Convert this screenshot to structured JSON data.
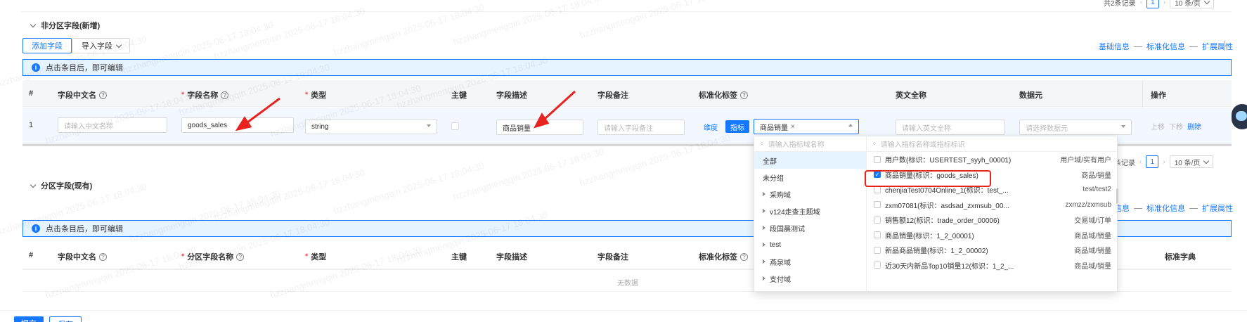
{
  "top_pager": {
    "total": "共2条记录",
    "page": "1",
    "size": "10 条/页"
  },
  "section1": {
    "title": "非分区字段(新增)",
    "add_btn": "添加字段",
    "import_btn": "导入字段",
    "steps": [
      "基础信息",
      "标准化信息",
      "扩展属性"
    ],
    "info": "点击条目后，即可编辑",
    "headers": {
      "idx": "#",
      "cn": "字段中文名",
      "name": "字段名称",
      "type": "类型",
      "pk": "主键",
      "desc": "字段描述",
      "remark": "字段备注",
      "tag": "标准化标签",
      "en": "英文全称",
      "meta": "数据元",
      "op": "操作"
    },
    "row": {
      "idx": "1",
      "cn_placeholder": "请输入中文名称",
      "name_value": "goods_sales",
      "type_value": "string",
      "desc_value": "商品销量",
      "remark_placeholder": "请输入字段备注",
      "tag_dim": "维度",
      "tag_ind": "指标",
      "tag_selected": "商品销量",
      "en_placeholder": "请输入英文全称",
      "meta_placeholder": "请选择数据元",
      "op_up": "上移",
      "op_down": "下移",
      "op_del": "删除"
    },
    "pager": {
      "total": "条记录",
      "page": "1",
      "size": "10 条/页"
    }
  },
  "section2": {
    "title": "分区字段(现有)",
    "steps": [
      "基础信息",
      "标准化信息",
      "扩展属性"
    ],
    "info": "点击条目后，即可编辑",
    "headers": {
      "idx": "#",
      "cn": "字段中文名",
      "name": "分区字段名称",
      "type": "类型",
      "pk": "主键",
      "desc": "字段描述",
      "remark": "字段备注",
      "tag": "标准化标签",
      "dict": "标准字典"
    },
    "empty": "无数据"
  },
  "dropdown": {
    "left_search_placeholder": "请输入指标域名称",
    "right_search_placeholder": "请输入指标名称或指标标识",
    "domains": [
      "全部",
      "未分组",
      "采购域",
      "v124走查主题域",
      "段国晨测试",
      "test",
      "燕泉域",
      "支付域"
    ],
    "options": [
      {
        "label": "用户数(标识：USERTEST_syyh_00001)",
        "domain": "用户域/实有用户",
        "checked": false
      },
      {
        "label": "商品销量(标识：goods_sales)",
        "domain": "商品/销量",
        "checked": true
      },
      {
        "label": "chenjiaTest0704Online_1(标识：test_...",
        "domain": "test/test2",
        "checked": false
      },
      {
        "label": "zxm07081(标识：asdsad_zxmsub_00...",
        "domain": "zxmzz/zxmsub",
        "checked": false
      },
      {
        "label": "销售额12(标识：trade_order_00006)",
        "domain": "交易域/订单",
        "checked": false
      },
      {
        "label": "商品销量(标识：1_2_00001)",
        "domain": "商品域/销量",
        "checked": false
      },
      {
        "label": "新品商品销量(标识：1_2_00002)",
        "domain": "商品域/销量",
        "checked": false
      },
      {
        "label": "近30天内新品Top10销量12(标识：1_2_...",
        "domain": "商品域/销量",
        "checked": false
      }
    ]
  },
  "footer": {
    "submit": "提交",
    "save": "保存"
  },
  "watermark": "hzzhangmengqin 2025-06-17 18:04:30",
  "colors": {
    "primary": "#1677ff",
    "annotation": "#e8221f"
  }
}
